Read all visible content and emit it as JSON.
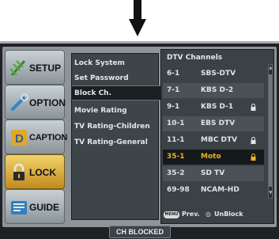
{
  "tabs": [
    {
      "label": "SETUP",
      "icon": "antenna-icon",
      "active": false
    },
    {
      "label": "OPTION",
      "icon": "wrench-icon",
      "active": false
    },
    {
      "label": "CAPTION",
      "icon": "caption-icon",
      "active": false
    },
    {
      "label": "LOCK",
      "icon": "padlock-icon",
      "active": true
    },
    {
      "label": "GUIDE",
      "icon": "guide-icon",
      "active": false
    }
  ],
  "menu": {
    "items": [
      "Lock System",
      "Set Password",
      "Block Ch.",
      "Movie Rating",
      "TV Rating-Children",
      "TV Rating-General"
    ],
    "selected_index": 2
  },
  "channels": {
    "title": "DTV Channels",
    "rows": [
      {
        "number": "6-1",
        "name": "SBS-DTV",
        "locked": false
      },
      {
        "number": "7-1",
        "name": "KBS D-2",
        "locked": false
      },
      {
        "number": "9-1",
        "name": "KBS D-1",
        "locked": true
      },
      {
        "number": "10-1",
        "name": "EBS DTV",
        "locked": false
      },
      {
        "number": "11-1",
        "name": "MBC DTV",
        "locked": true
      },
      {
        "number": "35-1",
        "name": "Moto",
        "locked": true
      },
      {
        "number": "35-2",
        "name": "SD TV",
        "locked": false
      },
      {
        "number": "69-98",
        "name": "NCAM-HD",
        "locked": false
      }
    ],
    "selected_index": 5
  },
  "help": {
    "menu_key": "MENU",
    "prev_label": "Prev.",
    "unblock_label": "UnBlock"
  },
  "status": "CH BLOCKED",
  "colors": {
    "active_tab": "#e0b23a",
    "selected_text": "#e8b423",
    "panel": "#3b4246"
  }
}
